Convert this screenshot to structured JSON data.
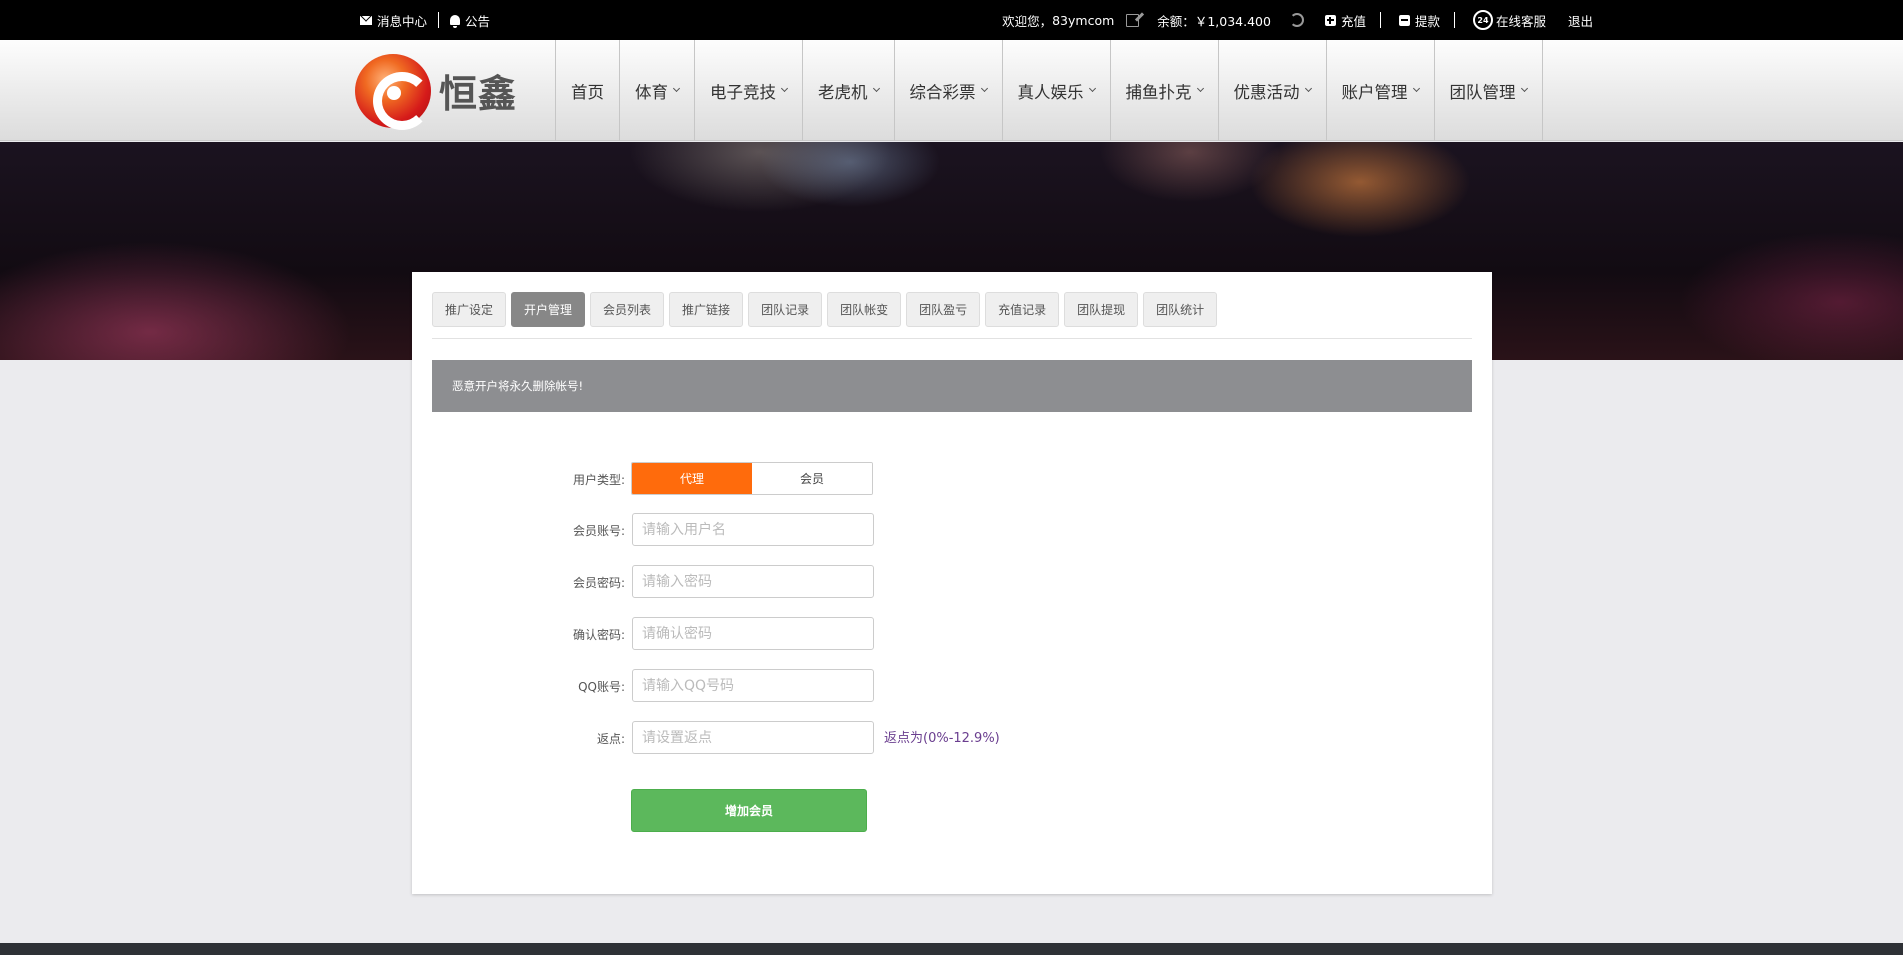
{
  "topbar": {
    "messages": "消息中心",
    "notice": "公告",
    "welcome": "欢迎您，",
    "username": "83ymcom",
    "balance_label": "余额：",
    "balance": "￥1,034.400",
    "deposit": "充值",
    "withdraw": "提款",
    "support_badge": "24",
    "support": "在线客服",
    "logout": "退出"
  },
  "brand": {
    "name": "恒鑫"
  },
  "nav": {
    "home": "首页",
    "sports": "体育",
    "esports": "电子竞技",
    "slots": "老虎机",
    "lottery": "综合彩票",
    "live": "真人娱乐",
    "fishing": "捕鱼扑克",
    "promos": "优惠活动",
    "account": "账户管理",
    "team": "团队管理"
  },
  "tabs": {
    "promo_settings": "推广设定",
    "account_open": "开户管理",
    "member_list": "会员列表",
    "promo_link": "推广链接",
    "team_records": "团队记录",
    "team_changes": "团队帐变",
    "team_profit": "团队盈亏",
    "deposit_records": "充值记录",
    "team_withdrawals": "团队提现",
    "team_stats": "团队统计"
  },
  "notice_text": "恶意开户将永久删除帐号!",
  "form": {
    "user_type_label": "用户类型:",
    "type_agent": "代理",
    "type_member": "会员",
    "account_label": "会员账号:",
    "account_placeholder": "请输入用户名",
    "password_label": "会员密码:",
    "password_placeholder": "请输入密码",
    "confirm_label": "确认密码:",
    "confirm_placeholder": "请确认密码",
    "qq_label": "QQ账号:",
    "qq_placeholder": "请输入QQ号码",
    "rebate_label": "返点:",
    "rebate_placeholder": "请设置返点",
    "rebate_hint": "返点为(0%-12.9%)",
    "submit": "增加会员"
  },
  "colors": {
    "accent_orange": "#ff6b0c",
    "submit_green": "#5cb85c",
    "active_tab": "#878787",
    "hint_purple": "#6a3e8f"
  }
}
